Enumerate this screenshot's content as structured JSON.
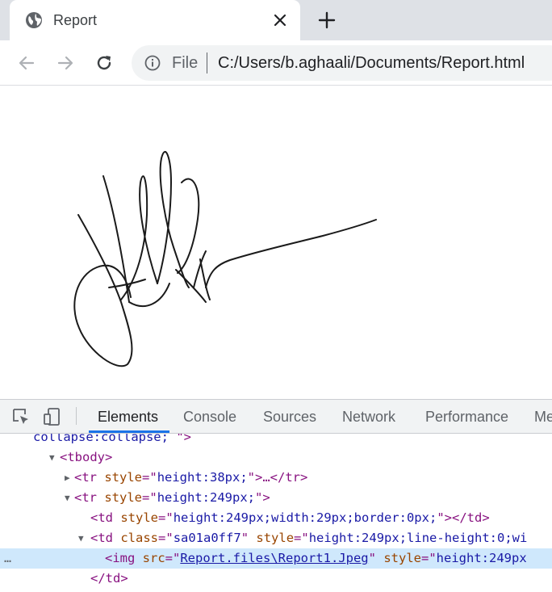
{
  "browser": {
    "tab_title": "Report",
    "new_tab_label": "+",
    "address": {
      "scheme": "File",
      "url": "C:/Users/b.aghaali/Documents/Report.html"
    }
  },
  "page": {
    "content": "signature image"
  },
  "devtools": {
    "tabs": [
      "Elements",
      "Console",
      "Sources",
      "Network",
      "Performance",
      "Me"
    ],
    "active_tab": "Elements",
    "dom_lines": [
      {
        "text_a": "collapse:collapse;",
        "text_b": "\">"
      },
      {
        "tag_open": "<tbody>"
      },
      {
        "tag": "<tr",
        "attr": "style",
        "val": "height:38px;",
        "rest": ">…</tr>"
      },
      {
        "tag": "<tr",
        "attr": "style",
        "val": "height:249px;",
        "rest": ">"
      },
      {
        "tag": "<td",
        "attr": "style",
        "val": "height:249px;width:29px;border:0px;",
        "rest": "></td>"
      },
      {
        "tag": "<td",
        "attr": "class",
        "val": "sa01a0ff7",
        "attr2": "style",
        "val2": "height:249px;line-height:0;wi"
      },
      {
        "tag": "<img",
        "attr": "src",
        "link": "Report.files\\Report1.Jpeg",
        "attr2": "style",
        "val2": "height:249px"
      },
      {
        "close": "</td>"
      }
    ],
    "selected_line_indicator": "…"
  },
  "colors": {
    "accent": "#1a73e8",
    "selected_row": "#cfe8fc",
    "tag": "#881280",
    "attr": "#994500",
    "value": "#1a1aa6"
  },
  "icons": [
    "globe-icon",
    "close-icon",
    "plus-icon",
    "back-icon",
    "forward-icon",
    "reload-icon",
    "info-icon",
    "inspect-icon",
    "device-toggle-icon"
  ]
}
